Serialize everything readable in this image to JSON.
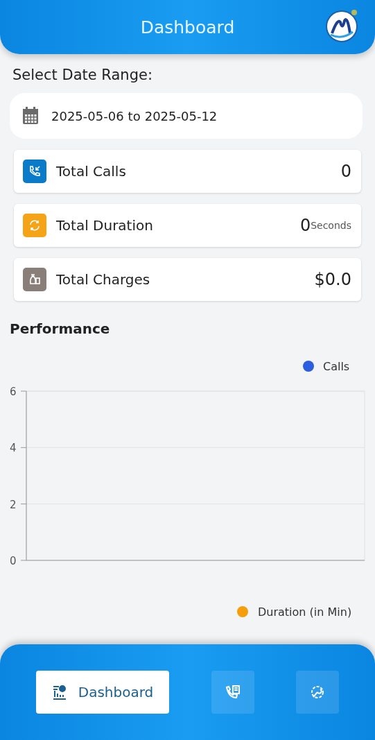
{
  "header": {
    "title": "Dashboard"
  },
  "date_range": {
    "label": "Select Date Range:",
    "start": "2025-05-06",
    "separator": "to",
    "end": "2025-05-12"
  },
  "stats": [
    {
      "label": "Total Calls",
      "value": "0",
      "color": "#0a7bc9"
    },
    {
      "label": "Total Duration",
      "value": "0",
      "unit": "Seconds",
      "color": "#f5a417"
    },
    {
      "label": "Total Charges",
      "value": "$0.0",
      "color": "#8a7f78"
    }
  ],
  "performance": {
    "title": "Performance",
    "charts": [
      {
        "chart_data": {
          "type": "line",
          "series": [
            {
              "name": "Calls",
              "color": "#2b5fe0"
            }
          ],
          "ylim": [
            0,
            6
          ],
          "yticks": [
            0,
            2,
            4,
            6
          ]
        }
      },
      {
        "legend": [
          {
            "name": "Duration (in Min)",
            "color": "#f59e0b"
          }
        ]
      }
    ]
  },
  "nav": [
    {
      "label": "Dashboard",
      "selected": true
    },
    {
      "selected": false
    },
    {
      "selected": false
    }
  ]
}
